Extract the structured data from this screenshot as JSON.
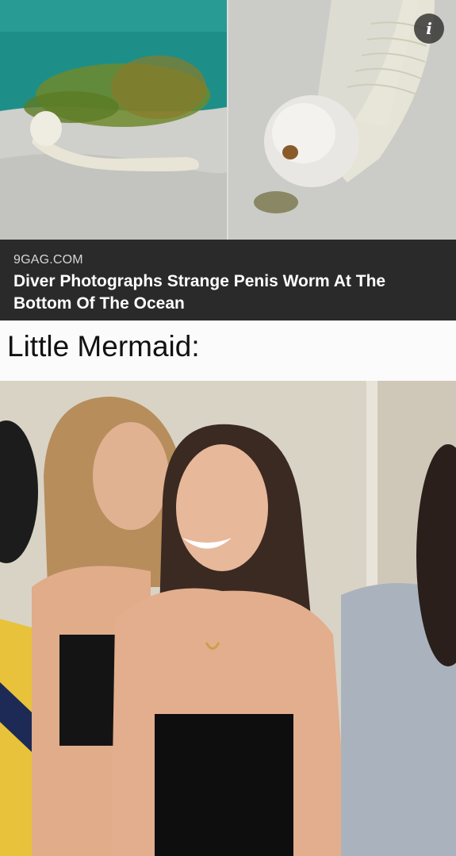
{
  "top_images": {
    "left_alt": "worm in the sand underwater",
    "right_alt": "close-up of worm head",
    "info_icon_glyph": "i"
  },
  "article": {
    "source": "9GAG.COM",
    "title": "Diver Photographs Strange Penis Worm At The Bottom Of The Ocean"
  },
  "caption": "Little Mermaid:",
  "colors": {
    "card_background": "#2a2a2a",
    "caption_background": "#fbfbfb",
    "ocean": "#1f8b86"
  }
}
